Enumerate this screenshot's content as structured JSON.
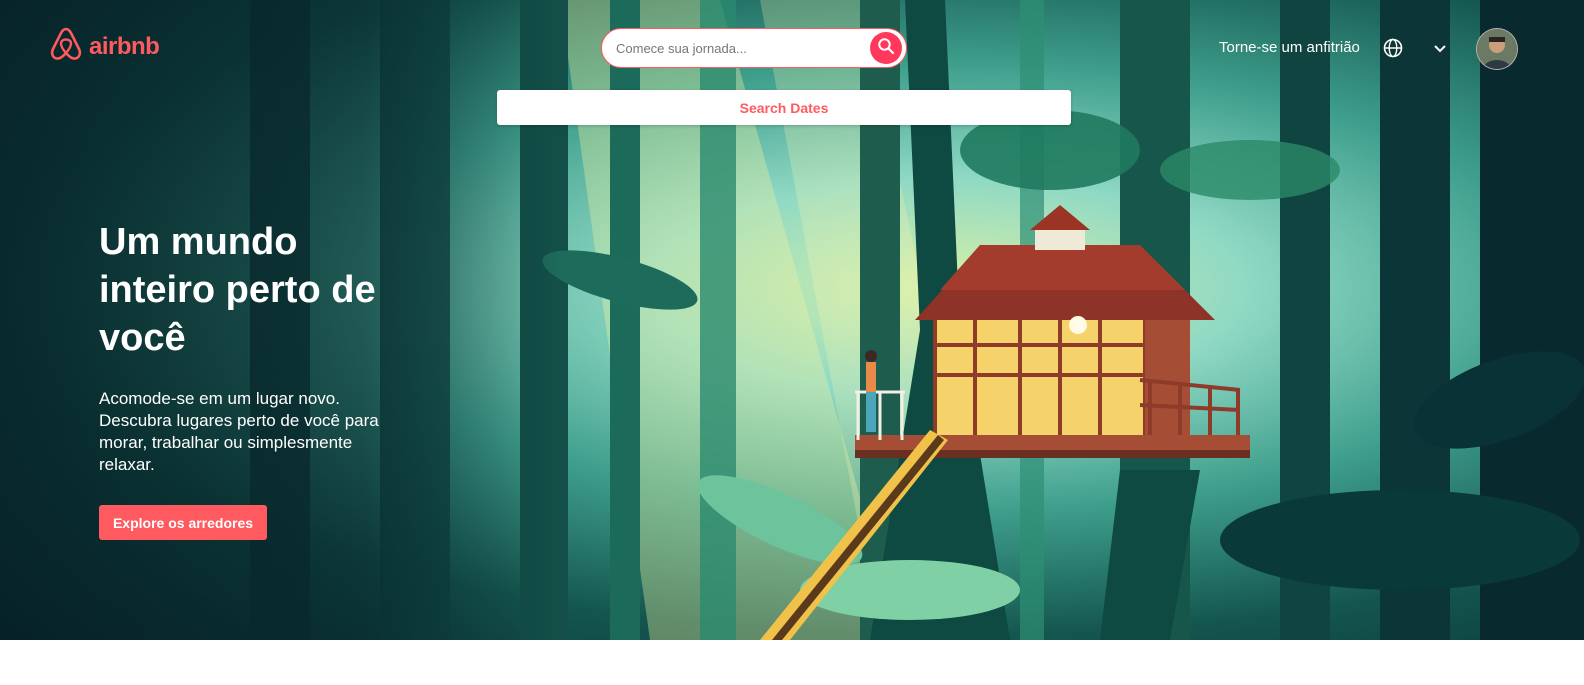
{
  "header": {
    "logo_text": "airbnb",
    "logo_icon": "airbnb-belo-icon",
    "search": {
      "placeholder": "Comece sua jornada...",
      "icon": "search-icon"
    },
    "host_link": "Torne-se um anfitrião",
    "globe_icon": "globe-icon",
    "menu_icon": "chevron-down-icon",
    "avatar": "user-avatar"
  },
  "search_dates": {
    "label": "Search Dates"
  },
  "hero": {
    "title": "Um mundo inteiro perto de você",
    "subtitle": "Acomode-se em um lugar novo. Descubra lugares perto de você para morar, trabalhar ou simplesmente relaxar.",
    "cta_label": "Explore os arredores",
    "illustration": "treehouse-forest-illustration"
  },
  "colors": {
    "brand": "#ff5a5f",
    "search_button": "#ff385c",
    "text_light": "#ffffff"
  }
}
